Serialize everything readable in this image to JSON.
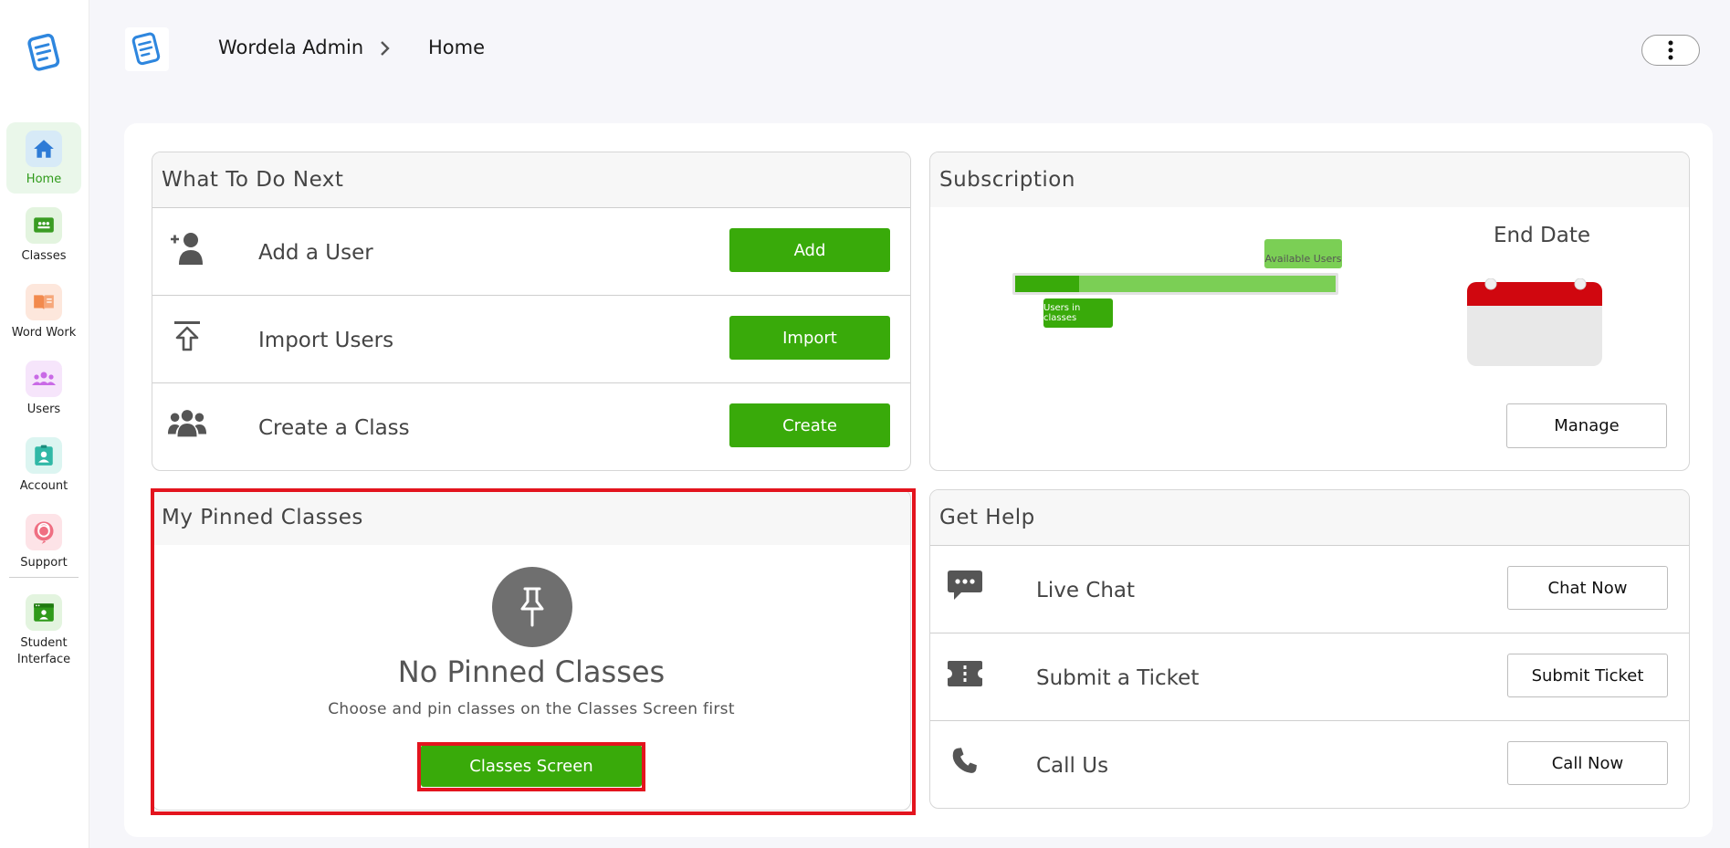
{
  "sidebar": {
    "items": [
      {
        "label": "Home",
        "icon": "home-icon",
        "color": "#2e7bd6",
        "bg": "#d7eaf7",
        "active": true
      },
      {
        "label": "Classes",
        "icon": "classes-icon",
        "color": "#3a9c23",
        "bg": "#e3f4df",
        "active": false
      },
      {
        "label": "Word Work",
        "icon": "book-icon",
        "color": "#f28a4d",
        "bg": "#fde7dc",
        "active": false
      },
      {
        "label": "Users",
        "icon": "users-icon",
        "color": "#c96ae6",
        "bg": "#f6e5fb",
        "active": false
      },
      {
        "label": "Account",
        "icon": "account-icon",
        "color": "#30b8a6",
        "bg": "#dcf5f1",
        "active": false
      },
      {
        "label": "Support",
        "icon": "support-icon",
        "color": "#ef6f82",
        "bg": "#fde3e7",
        "active": false
      },
      {
        "label": "Student Interface",
        "icon": "student-interface-icon",
        "color": "#2f9a1a",
        "bg": "#e3f4df",
        "active": false
      }
    ]
  },
  "header": {
    "app": "Wordela Admin",
    "page": "Home"
  },
  "todo": {
    "title": "What To Do Next",
    "rows": [
      {
        "label": "Add a User",
        "button": "Add",
        "icon": "add-user-icon"
      },
      {
        "label": "Import Users",
        "button": "Import",
        "icon": "import-icon"
      },
      {
        "label": "Create a Class",
        "button": "Create",
        "icon": "group-icon"
      }
    ]
  },
  "subscription": {
    "title": "Subscription",
    "available_label": "Available Users",
    "used_label": "Users in classes",
    "used_fraction": 0.2,
    "end_date_label": "End Date",
    "manage_label": "Manage"
  },
  "pinned": {
    "title": "My Pinned Classes",
    "empty_title": "No Pinned Classes",
    "empty_text": "Choose and pin classes on the Classes Screen first",
    "button": "Classes Screen"
  },
  "help": {
    "title": "Get Help",
    "rows": [
      {
        "label": "Live Chat",
        "button": "Chat Now",
        "icon": "chat-icon"
      },
      {
        "label": "Submit a Ticket",
        "button": "Submit Ticket",
        "icon": "ticket-icon"
      },
      {
        "label": "Call Us",
        "button": "Call Now",
        "icon": "phone-icon"
      }
    ]
  },
  "colors": {
    "accent_green": "#39aa0a",
    "bar_light": "#7bcf55",
    "calendar_red": "#d0070f",
    "highlight": "#e3141e"
  }
}
